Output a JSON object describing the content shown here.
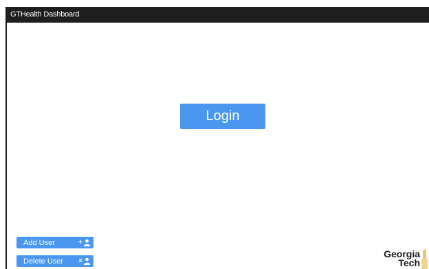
{
  "window": {
    "title": "GTHealth Dashboard"
  },
  "main": {
    "login_label": "Login"
  },
  "sidebar": {
    "add_user_label": "Add User",
    "add_user_icon": "add-user-icon",
    "delete_user_label": "Delete User",
    "delete_user_icon": "remove-user-icon"
  },
  "logo": {
    "line1": "Georgia",
    "line2": "Tech"
  },
  "colors": {
    "accent": "#4a97ef",
    "titlebar": "#1e1e1e",
    "logo_gold": "#e9c46a"
  }
}
